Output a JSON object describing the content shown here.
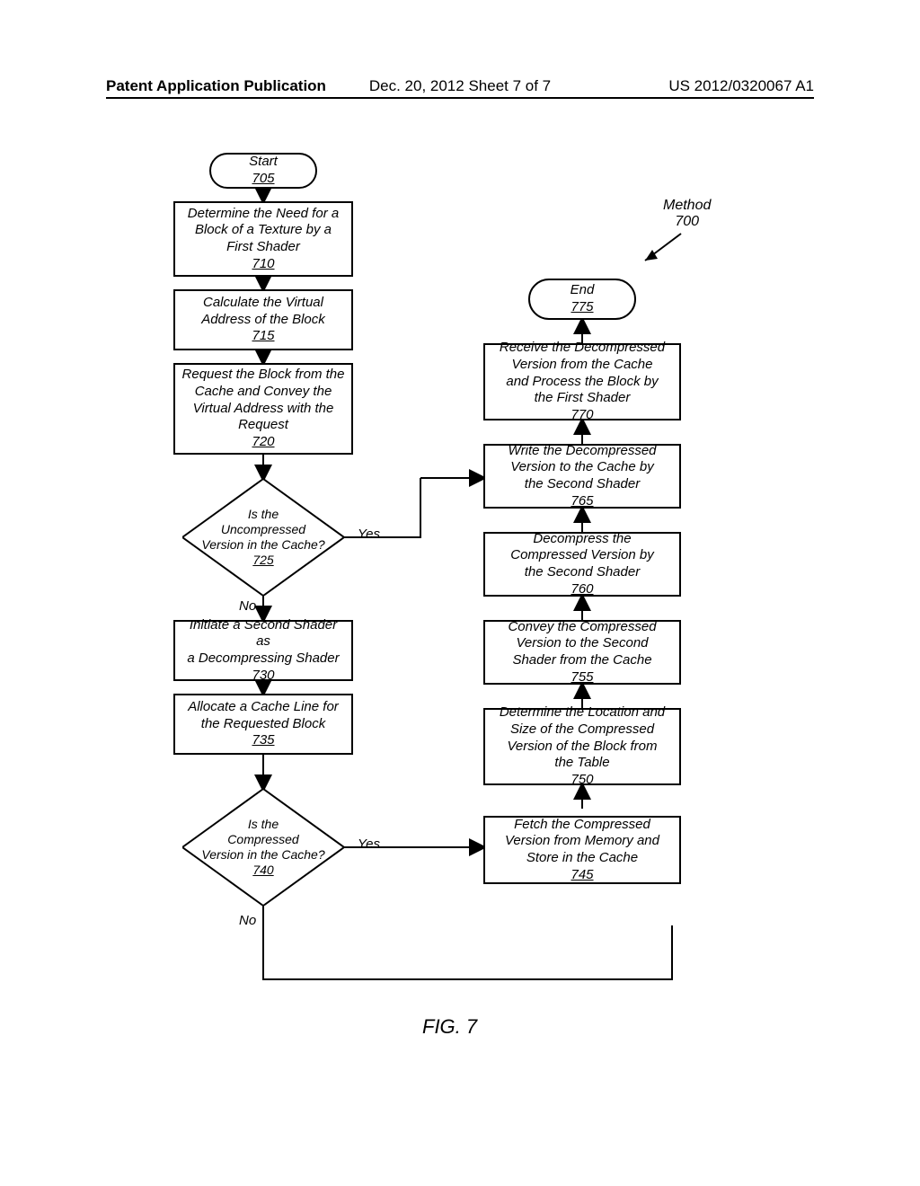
{
  "header": {
    "left": "Patent Application Publication",
    "center": "Dec. 20, 2012  Sheet 7 of 7",
    "right": "US 2012/0320067 A1"
  },
  "method": {
    "label": "Method",
    "ref": "700"
  },
  "nodes": {
    "start": {
      "text": "Start",
      "ref": "705"
    },
    "n710": {
      "text": "Determine the Need for a\nBlock of a Texture by a\nFirst Shader",
      "ref": "710"
    },
    "n715": {
      "text": "Calculate the Virtual\nAddress of the Block",
      "ref": "715"
    },
    "n720": {
      "text": "Request the Block from the\nCache and Convey the\nVirtual Address with the\nRequest",
      "ref": "720"
    },
    "d725": {
      "text": "Is the\nUncompressed\nVersion in the Cache?",
      "ref": "725"
    },
    "n730": {
      "text": "Initiate a Second Shader as\na Decompressing Shader",
      "ref": "730"
    },
    "n735": {
      "text": "Allocate a Cache Line for\nthe Requested Block",
      "ref": "735"
    },
    "d740": {
      "text": "Is the\nCompressed\nVersion in the Cache?",
      "ref": "740"
    },
    "n745": {
      "text": "Fetch the Compressed\nVersion from Memory and\nStore in the Cache",
      "ref": "745"
    },
    "n750": {
      "text": "Determine the Location and\nSize of the Compressed\nVersion of the Block from\nthe Table",
      "ref": "750"
    },
    "n755": {
      "text": "Convey the Compressed\nVersion to the Second\nShader from the Cache",
      "ref": "755"
    },
    "n760": {
      "text": "Decompress the\nCompressed Version by\nthe Second Shader",
      "ref": "760"
    },
    "n765": {
      "text": "Write the Decompressed\nVersion to the Cache by\nthe Second Shader",
      "ref": "765"
    },
    "n770": {
      "text": "Receive the Decompressed\nVersion from the Cache\nand Process the Block by\nthe First Shader",
      "ref": "770"
    },
    "end": {
      "text": "End",
      "ref": "775"
    }
  },
  "labels": {
    "yes": "Yes",
    "no": "No"
  },
  "figure": "FIG. 7"
}
